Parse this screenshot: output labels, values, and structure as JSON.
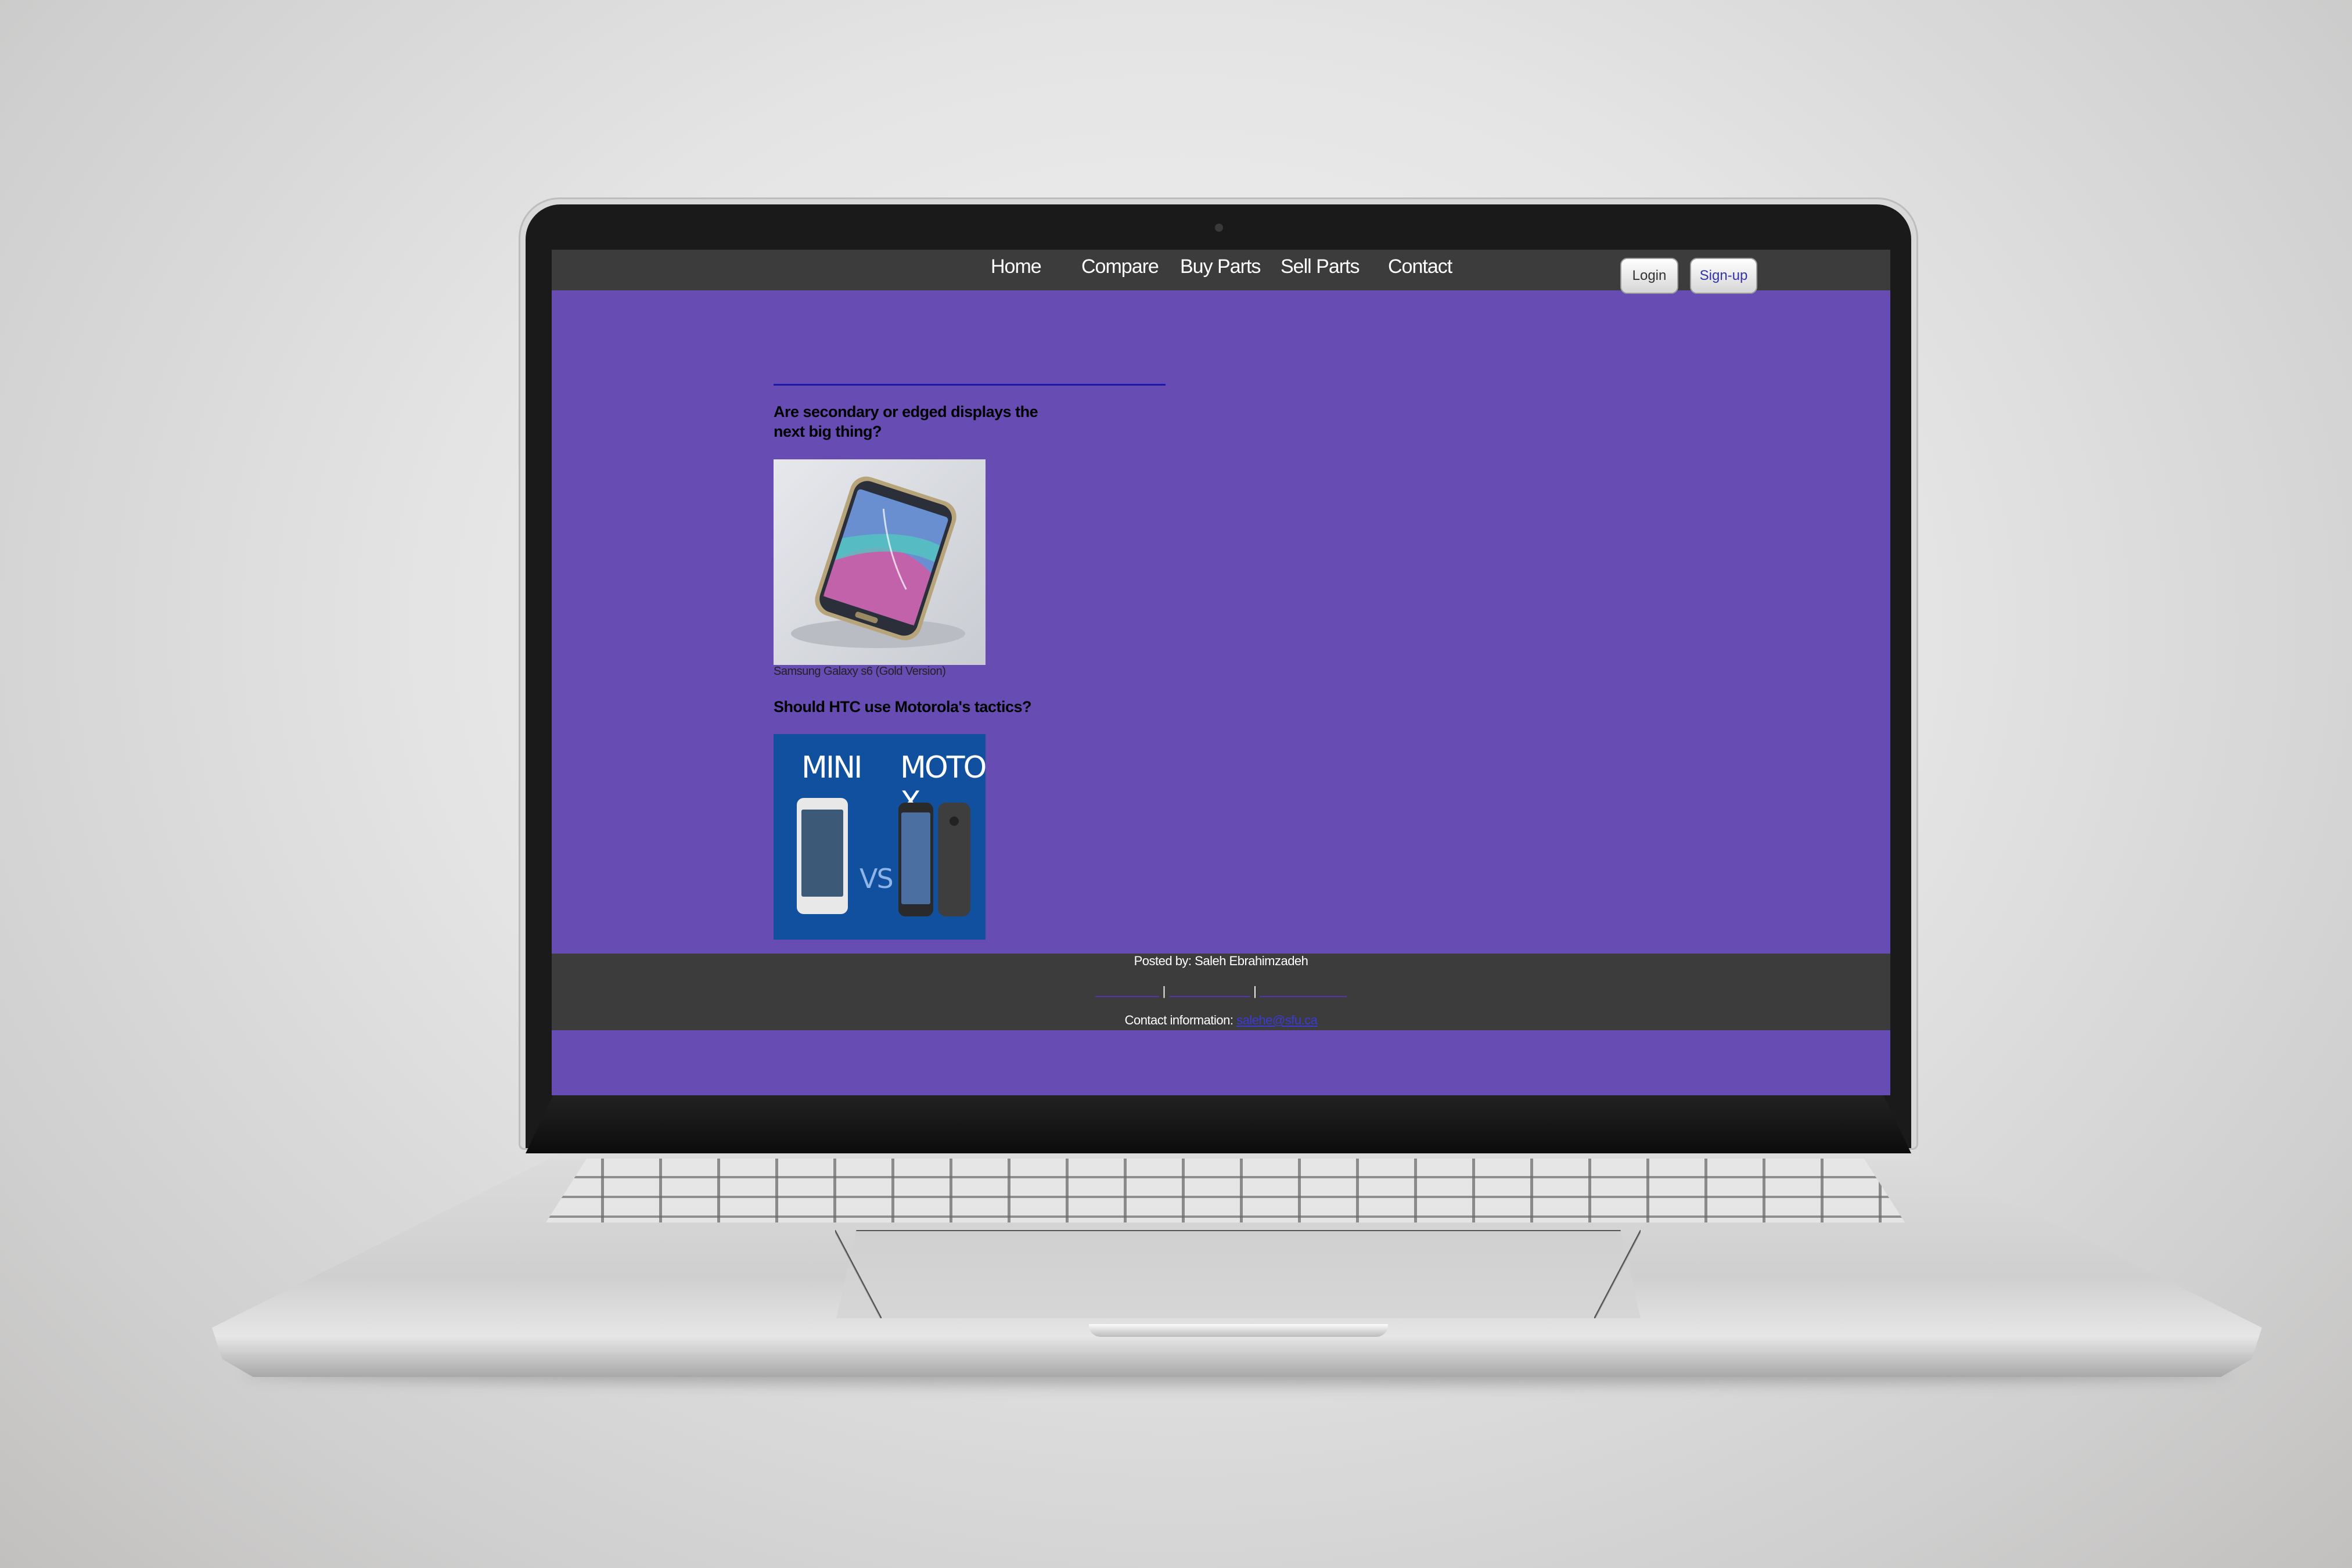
{
  "nav": {
    "items": [
      {
        "label": "Home"
      },
      {
        "label": "Compare"
      },
      {
        "label": "Buy Parts"
      },
      {
        "label": "Sell Parts"
      },
      {
        "label": "Contact"
      }
    ],
    "login_label": "Login",
    "signup_label": "Sign-up"
  },
  "main": {
    "article1_title": "Are secondary or edged displays the next big thing?",
    "article1_caption": "Samsung Galaxy s6 (Gold Version)",
    "article2_title": "Should HTC use Motorola's tactics?",
    "image2_left_label": "MINI",
    "image2_vs_label": "VS",
    "image2_right_label": "MOTO X"
  },
  "footer": {
    "posted_by": "Posted by: Saleh Ebrahimzadeh",
    "contact_label": "Contact information: ",
    "contact_email": "salehe@sfu.ca"
  },
  "colors": {
    "page_background": "#664cb3",
    "bar_background": "#3c3c3c",
    "divider": "#1a1aa8"
  }
}
